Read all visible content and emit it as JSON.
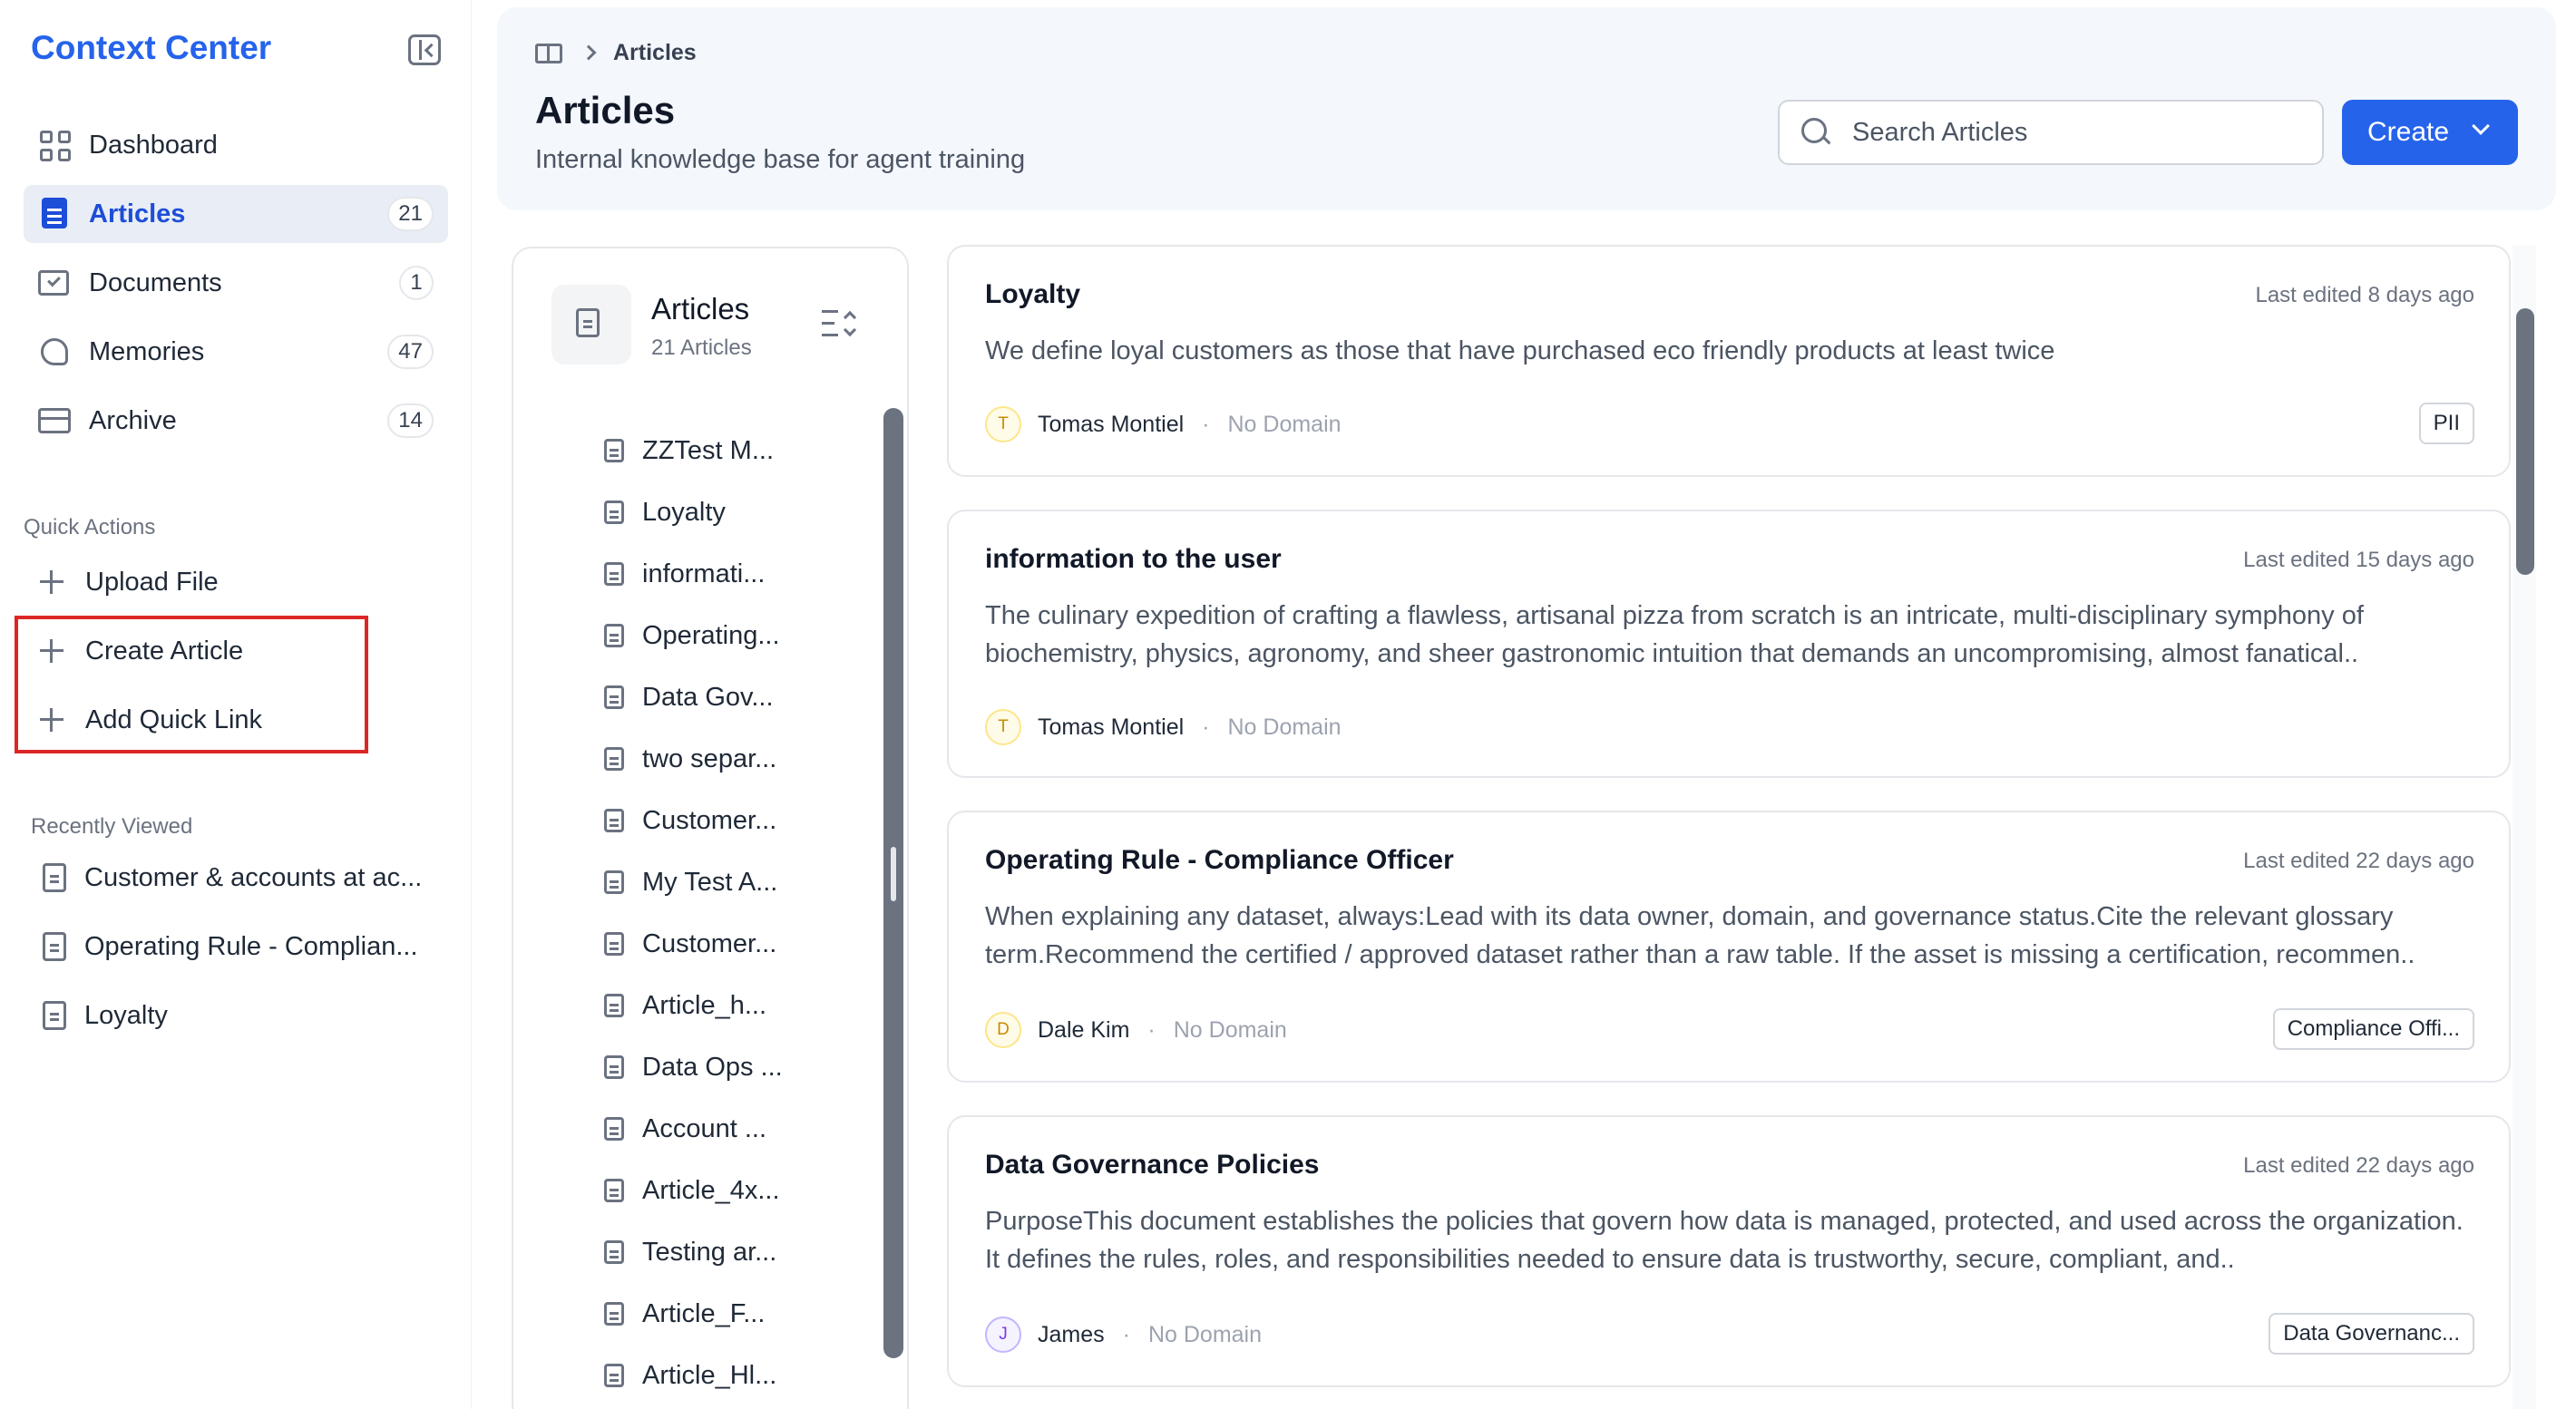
{
  "sidebar": {
    "brand": "Context Center",
    "nav": [
      {
        "label": "Dashboard",
        "count": "",
        "icon": "dashboard-icon"
      },
      {
        "label": "Articles",
        "count": "21",
        "icon": "articles-icon"
      },
      {
        "label": "Documents",
        "count": "1",
        "icon": "documents-icon"
      },
      {
        "label": "Memories",
        "count": "47",
        "icon": "memories-icon"
      },
      {
        "label": "Archive",
        "count": "14",
        "icon": "archive-icon"
      }
    ],
    "quick_actions_title": "Quick Actions",
    "quick_actions": [
      {
        "label": "Upload File"
      },
      {
        "label": "Create Article"
      },
      {
        "label": "Add Quick Link"
      }
    ],
    "recently_viewed_title": "Recently Viewed",
    "recent": [
      {
        "label": "Customer & accounts at ac..."
      },
      {
        "label": "Operating Rule - Complian..."
      },
      {
        "label": "Loyalty"
      }
    ]
  },
  "header": {
    "breadcrumb": "Articles",
    "title": "Articles",
    "subtitle": "Internal knowledge base for agent training",
    "search_placeholder": "Search Articles",
    "create_label": "Create"
  },
  "list": {
    "title": "Articles",
    "subtitle": "21 Articles",
    "items": [
      "ZZTest M...",
      "Loyalty",
      "informati...",
      "Operating...",
      "Data Gov...",
      "two separ...",
      "Customer...",
      "My Test A...",
      "Customer...",
      "Article_h...",
      "Data Ops ...",
      "Account ...",
      "Article_4x...",
      "Testing ar...",
      "Article_F...",
      "Article_Hl..."
    ]
  },
  "cards": [
    {
      "title": "Loyalty",
      "time": "Last edited 8 days ago",
      "body": "We define loyal customers as those that have purchased eco friendly products at least twice",
      "avatar": "T",
      "avatar_color": "#ca8a04",
      "author": "Tomas Montiel",
      "domain": "No Domain",
      "tag": "PII"
    },
    {
      "title": "information to the user",
      "time": "Last edited 15 days ago",
      "body": "The culinary expedition of crafting a flawless, artisanal pizza from scratch is an intricate, multi-disciplinary symphony of biochemistry, physics, agronomy, and sheer gastronomic intuition that demands an uncompromising, almost fanatical..",
      "avatar": "T",
      "avatar_color": "#ca8a04",
      "author": "Tomas Montiel",
      "domain": "No Domain",
      "tag": ""
    },
    {
      "title": "Operating Rule - Compliance Officer",
      "time": "Last edited 22 days ago",
      "body": "When explaining any dataset, always:Lead with its data owner, domain, and governance status.Cite the relevant glossary term.Recommend the certified / approved dataset rather than a raw table. If the asset is missing a certification, recommen..",
      "avatar": "D",
      "avatar_color": "#ca8a04",
      "author": "Dale Kim",
      "domain": "No Domain",
      "tag": "Compliance Offi..."
    },
    {
      "title": "Data Governance Policies",
      "time": "Last edited 22 days ago",
      "body": "PurposeThis document establishes the policies that govern how data is managed, protected, and used across the organization. It defines the rules, roles, and responsibilities needed to ensure data is trustworthy, secure, compliant, and..",
      "avatar": "J",
      "avatar_color": "#7c3aed",
      "author": "James",
      "domain": "No Domain",
      "tag": "Data Governanc..."
    }
  ]
}
